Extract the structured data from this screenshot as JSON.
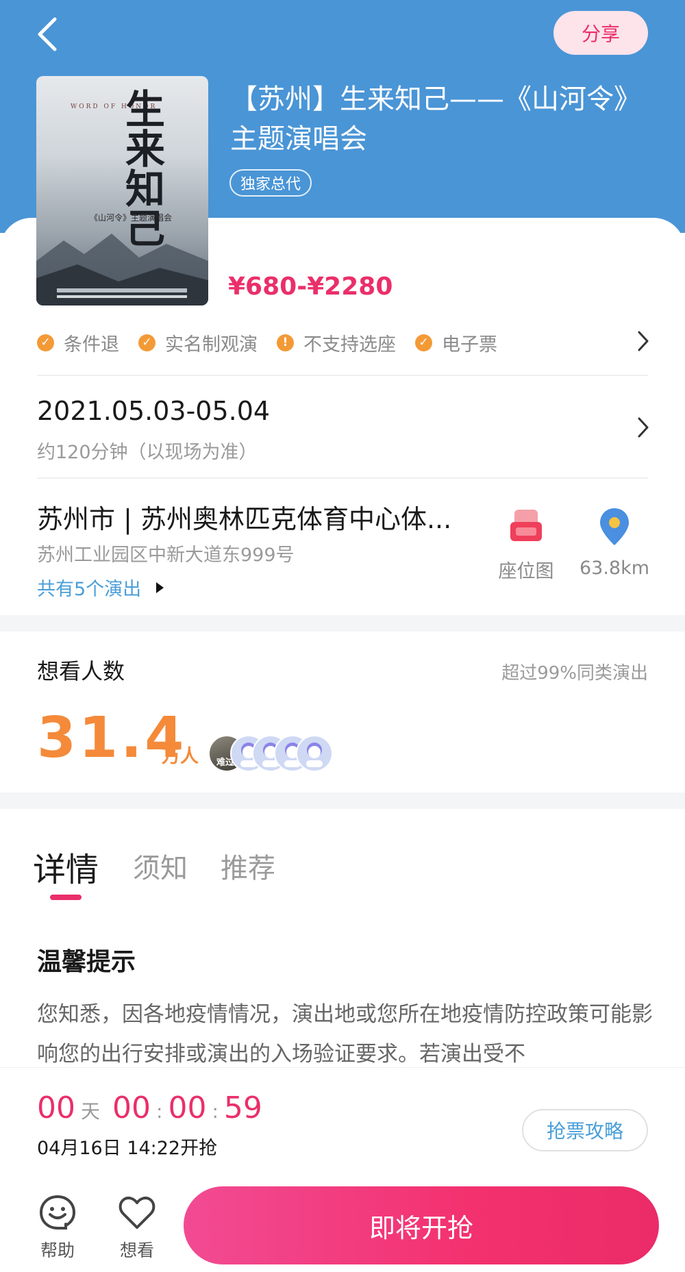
{
  "header": {
    "share_label": "分享",
    "back_icon": "chevron-left-icon",
    "bg_color": "#4a95d6"
  },
  "event": {
    "title": "【苏州】生来知己——《山河令》主题演唱会",
    "badge": "独家总代",
    "price": "¥680-¥2280",
    "poster": {
      "calligraphy": "生来知己",
      "english": "WORD OF HONOR",
      "subtitle": "《山河令》主题演唱会"
    }
  },
  "features": [
    {
      "label": "条件退",
      "icon": "check-circle-icon",
      "mark": "✓"
    },
    {
      "label": "实名制观演",
      "icon": "check-circle-icon",
      "mark": "✓"
    },
    {
      "label": "不支持选座",
      "icon": "exclamation-circle-icon",
      "mark": "!"
    },
    {
      "label": "电子票",
      "icon": "check-circle-icon",
      "mark": "✓"
    }
  ],
  "schedule": {
    "date": "2021.05.03-05.04",
    "duration": "约120分钟（以现场为准）"
  },
  "venue": {
    "name": "苏州市 | 苏州奥林匹克体育中心体...",
    "address": "苏州工业园区中新大道东999号",
    "shows": "共有5个演出",
    "seat_map_label": "座位图",
    "distance": "63.8km"
  },
  "wish": {
    "title": "想看人数",
    "compare": "超过99%同类演出",
    "count": "31.4",
    "unit": "万人",
    "avatar_photo_caption": "难过"
  },
  "tabs": [
    {
      "label": "详情",
      "active": true
    },
    {
      "label": "须知",
      "active": false
    },
    {
      "label": "推荐",
      "active": false
    }
  ],
  "notice": {
    "title": "温馨提示",
    "text": "您知悉，因各地疫情情况，演出地或您所在地疫情防控政策可能影响您的出行安排或演出的入场验证要求。若演出受不"
  },
  "countdown": {
    "days": "00",
    "days_unit": "天",
    "hours": "00",
    "minutes": "00",
    "seconds": "59",
    "separator": ":",
    "start_time": "04月16日 14:22开抢"
  },
  "footer": {
    "strategy_label": "抢票攻略",
    "help_label": "帮助",
    "want_label": "想看",
    "buy_label": "即将开抢"
  },
  "colors": {
    "accent_pink": "#ea2f6a",
    "accent_orange": "#f48a3a",
    "link_blue": "#4a9ed8"
  }
}
